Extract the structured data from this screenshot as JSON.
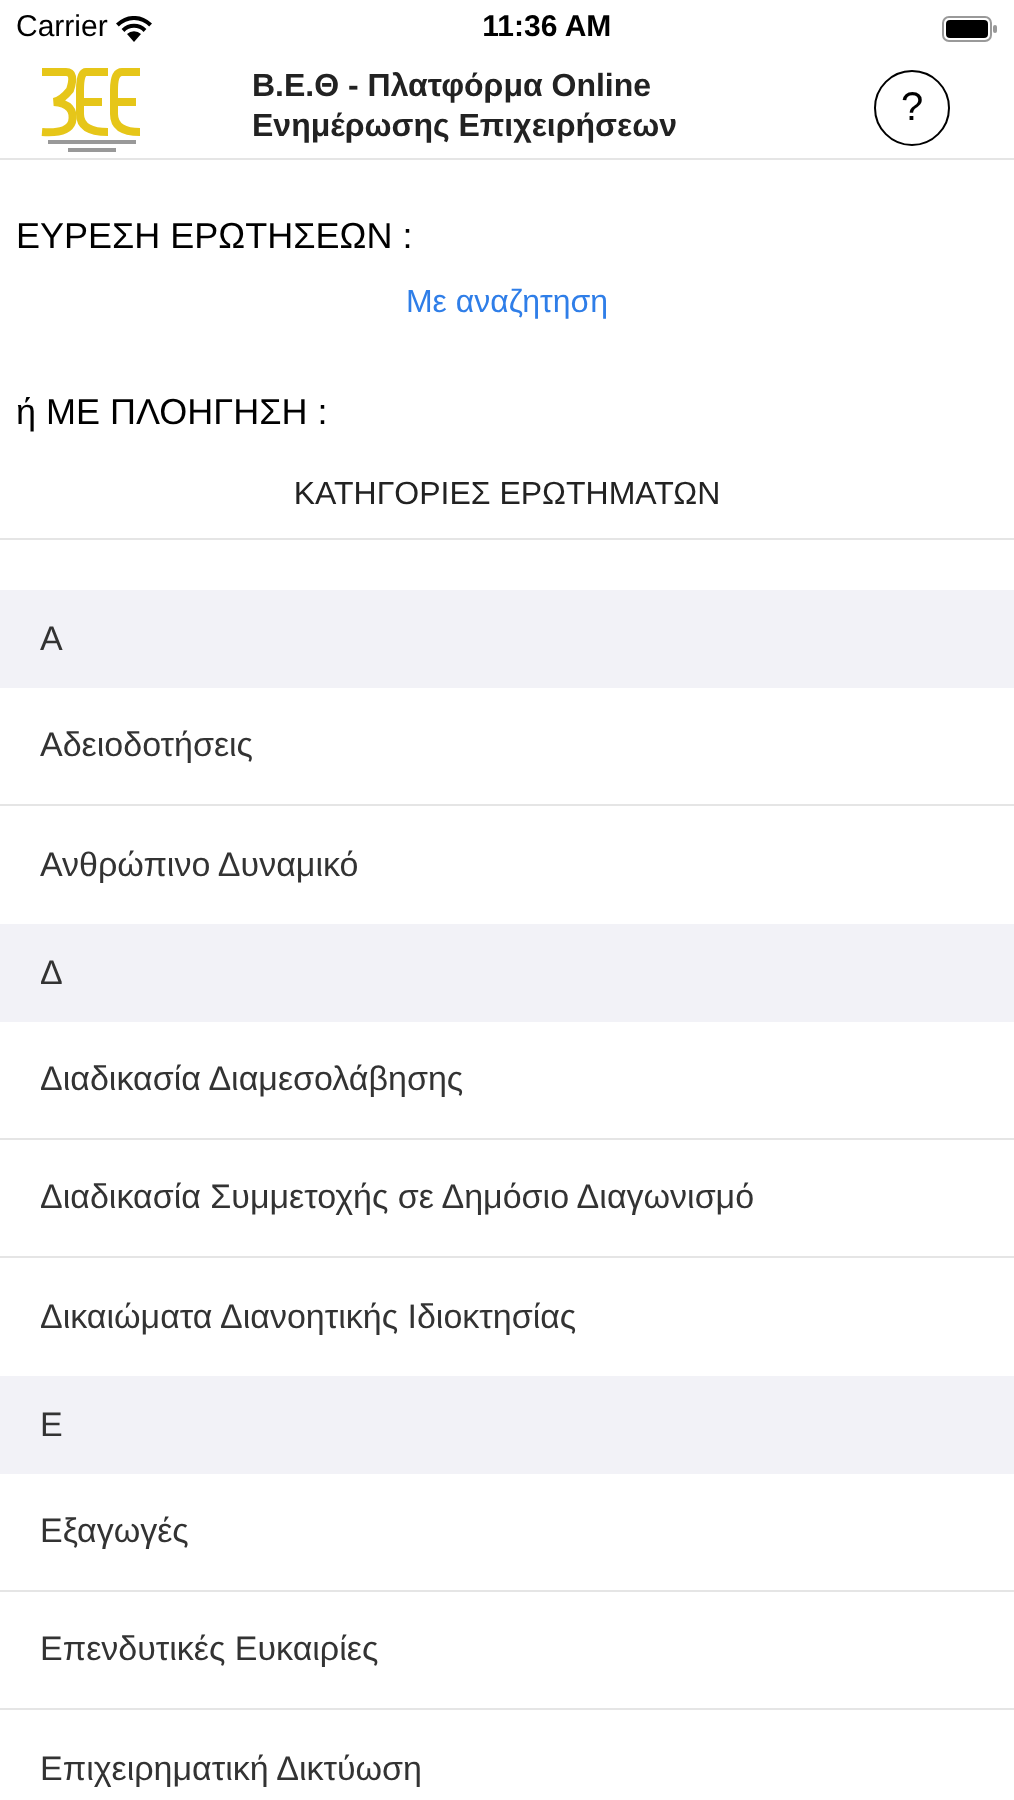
{
  "status_bar": {
    "carrier": "Carrier",
    "time": "11:36 AM"
  },
  "header": {
    "title_line_1": "Β.Ε.Θ - Πλατφόρμα Online",
    "title_line_2": "Ενημέρωσης Επιχειρήσεων",
    "help": "?"
  },
  "search_heading": "ΕΥΡΕΣΗ ΕΡΩΤΗΣΕΩΝ :",
  "search_link": "Με αναζητηση",
  "browse_heading": "ή ΜΕ ΠΛΟΗΓΗΣΗ :",
  "categories_title": "ΚΑΤΗΓΟΡΙΕΣ ΕΡΩΤΗΜΑΤΩΝ",
  "sections": [
    {
      "letter": "Α",
      "items": [
        "Αδειοδοτήσεις",
        "Ανθρώπινο Δυναμικό"
      ]
    },
    {
      "letter": "Δ",
      "items": [
        "Διαδικασία Διαμεσολάβησης",
        "Διαδικασία Συμμετοχής σε Δημόσιο Διαγωνισμό",
        "Δικαιώματα Διανοητικής Ιδιοκτησίας"
      ]
    },
    {
      "letter": "Ε",
      "items": [
        "Εξαγωγές",
        "Επενδυτικές Ευκαιρίες",
        "Επιχειρηματική Δικτύωση"
      ]
    }
  ]
}
